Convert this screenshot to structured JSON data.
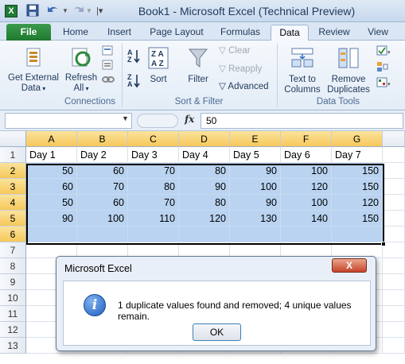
{
  "window": {
    "title": "Book1 - Microsoft Excel (Technical Preview)",
    "app_icon": "X"
  },
  "tabs": [
    "File",
    "Home",
    "Insert",
    "Page Layout",
    "Formulas",
    "Data",
    "Review",
    "View"
  ],
  "ribbon": {
    "get_external_data": "Get External Data",
    "refresh_all": "Refresh All",
    "connections_group": "Connections",
    "sort": "Sort",
    "filter": "Filter",
    "clear": "Clear",
    "reapply": "Reapply",
    "advanced": "Advanced",
    "sort_filter_group": "Sort & Filter",
    "text_to_columns": "Text to Columns",
    "remove_duplicates": "Remove Duplicates",
    "data_tools_group": "Data Tools"
  },
  "formula_bar": {
    "fx": "fx",
    "value": "50"
  },
  "sheet": {
    "columns": [
      "A",
      "B",
      "C",
      "D",
      "E",
      "F",
      "G"
    ],
    "rows": [
      "1",
      "2",
      "3",
      "4",
      "5",
      "6",
      "7",
      "8",
      "9",
      "10",
      "11",
      "12",
      "13"
    ],
    "header_row": [
      "Day 1",
      "Day 2",
      "Day 3",
      "Day 4",
      "Day 5",
      "Day 6",
      "Day 7"
    ],
    "data": [
      [
        "50",
        "60",
        "70",
        "80",
        "90",
        "100",
        "150"
      ],
      [
        "60",
        "70",
        "80",
        "90",
        "100",
        "120",
        "150"
      ],
      [
        "50",
        "60",
        "70",
        "80",
        "90",
        "100",
        "120"
      ],
      [
        "90",
        "100",
        "110",
        "120",
        "130",
        "140",
        "150"
      ]
    ]
  },
  "dialog": {
    "title": "Microsoft Excel",
    "close_symbol": "X",
    "info_symbol": "i",
    "message": "1 duplicate values found and removed; 4 unique values remain.",
    "ok": "OK"
  },
  "colors": {
    "selection": "#b9d3f0",
    "header_selected": "#f6c85a",
    "file_tab": "#1e7a30"
  }
}
